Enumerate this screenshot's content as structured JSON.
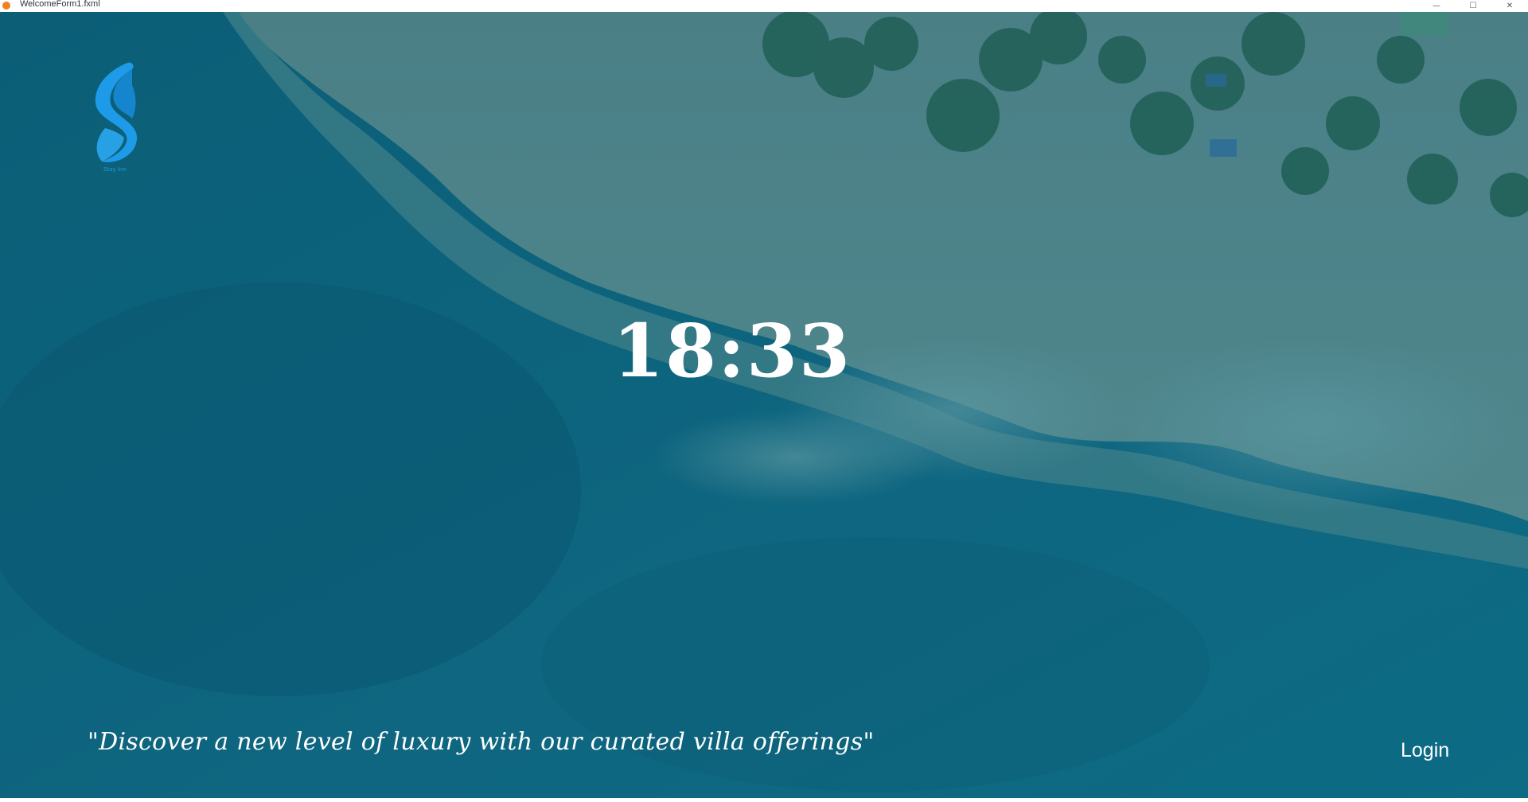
{
  "window": {
    "title": "WelcomeForm1.fxml",
    "controls": {
      "minimize": "—",
      "maximize": "☐",
      "close": "✕"
    }
  },
  "welcome": {
    "logo_icon": "s-brand-logo",
    "clock_time": "18:33",
    "tagline": "\"Discover a new level of luxury with our curated villa offerings\"",
    "login_label": "Login"
  },
  "colors": {
    "overlay": "#0f5f78",
    "logo_blue": "#1e9be8",
    "text": "#ffffff"
  }
}
